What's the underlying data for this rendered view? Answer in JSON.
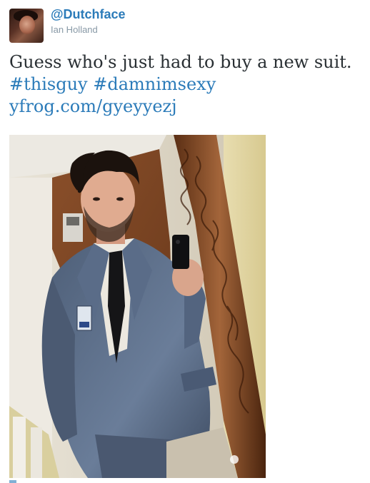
{
  "user": {
    "handle": "@Dutchface",
    "name": "Ian Holland"
  },
  "tweet": {
    "text": "Guess who's just had to buy a new suit.",
    "hashtags": [
      "#thisguy",
      "#damnimsexy"
    ],
    "link": "yfrog.com/gyeyyezj"
  },
  "colors": {
    "link": "#2b7bb9",
    "text": "#292f33",
    "muted": "#8899a6"
  },
  "icons": {
    "avatar": "profile-photo",
    "photo": "mirror-selfie-suit"
  }
}
